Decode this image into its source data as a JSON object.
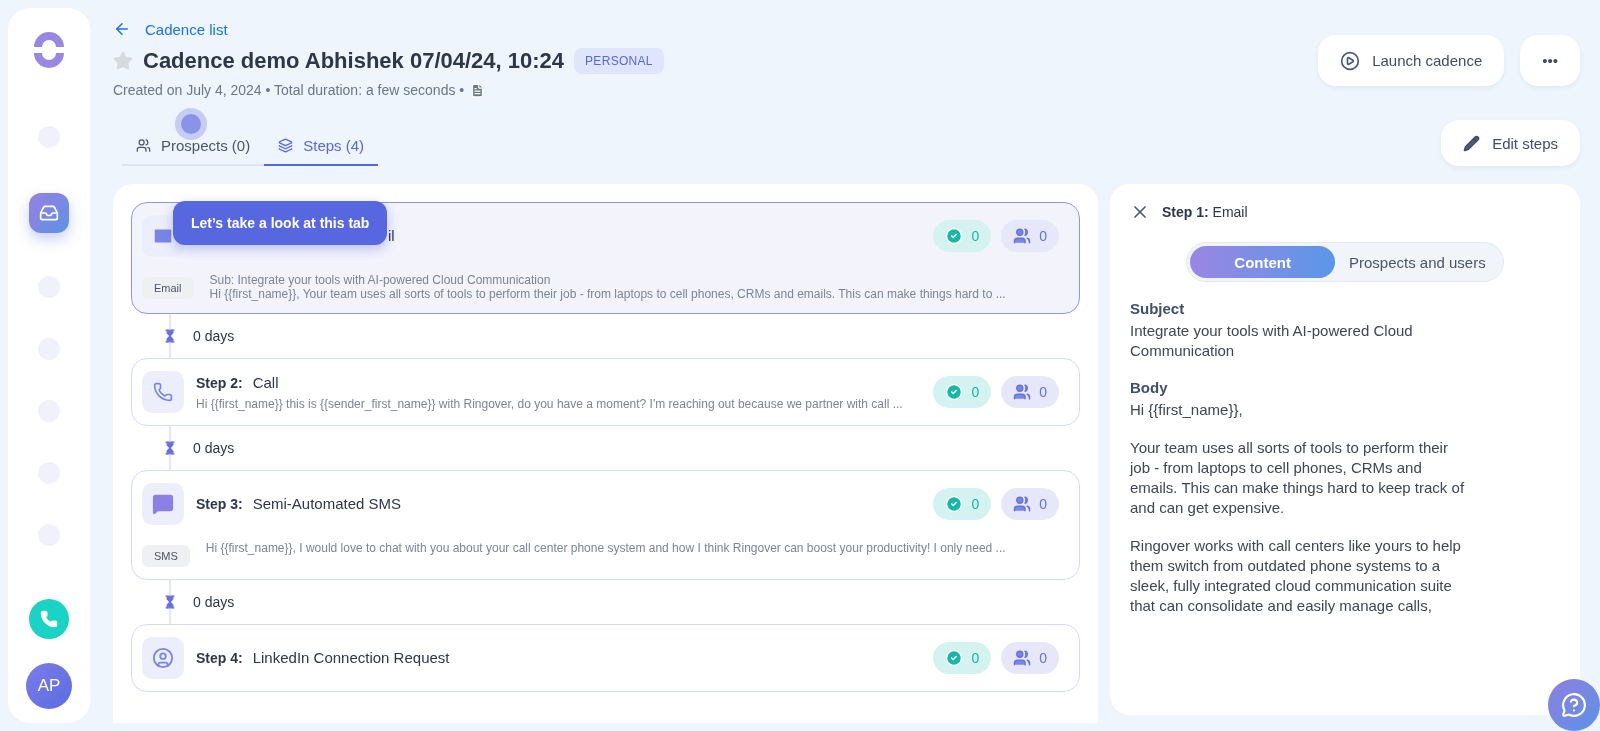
{
  "back_link": {
    "label": "Cadence list"
  },
  "header": {
    "starred": false,
    "title": "Cadence demo Abhishek 07/04/24, 10:24",
    "badge": "PERSONAL",
    "subtitle": "Created on July 4, 2024 • Total duration: a few seconds •"
  },
  "actions": [
    {
      "kind": "launch",
      "label": "Launch cadence"
    },
    {
      "kind": "more",
      "label": "•••"
    }
  ],
  "tabs": [
    {
      "kind": "prospects",
      "label": "Prospects (0)",
      "selected": false
    },
    {
      "kind": "steps",
      "label": "Steps (4)",
      "selected": true
    }
  ],
  "edit_button": {
    "label": "Edit steps"
  },
  "tooltip": {
    "text": "Let’s take a look at this tab"
  },
  "steps": [
    {
      "kind": "email",
      "title": "il",
      "tag": "Email",
      "lines": [
        "Sub: Integrate your tools with AI-powered Cloud Communication",
        "Hi {{first_name}},   Your team uses all sorts of tools to perform their job - from laptops to cell phones, CRMs and emails. This can make things hard to ..."
      ],
      "done": "0",
      "people": "0",
      "selected": true
    },
    {
      "kind": "call",
      "label": "Step 2:",
      "title": "Call",
      "lines": [
        "Hi {{first_name}} this is {{sender_first_name}} with Ringover, do you have a moment? I'm reaching out because we partner with call ..."
      ],
      "done": "0",
      "people": "0",
      "selected": false
    },
    {
      "kind": "sms",
      "label": "Step 3:",
      "title": "Semi-Automated SMS",
      "tag": "SMS",
      "lines": [
        "Hi {{first_name}}, I would love to chat with you about your call center phone system and how I think Ringover can boost your productivity! I only need ..."
      ],
      "done": "0",
      "people": "0",
      "selected": false
    },
    {
      "kind": "linkedin",
      "label": "Step 4:",
      "title": "LinkedIn Connection Request",
      "done": "0",
      "people": "0",
      "selected": false
    }
  ],
  "delays": [
    "0 days",
    "0 days",
    "0 days"
  ],
  "detail": {
    "label": "Step 1:",
    "title": "Email",
    "toggle": [
      {
        "label": "Content",
        "selected": true
      },
      {
        "label": "Prospects and users",
        "selected": false
      }
    ],
    "subject_heading": "Subject",
    "subject": "Integrate your tools with AI-powered Cloud Communication",
    "body_heading": "Body",
    "body": [
      "Hi {{first_name}},",
      "Your team uses all sorts of tools to perform their job - from laptops to cell phones, CRMs and emails. This can make things hard to keep track of and can get expensive.",
      "Ringover works with call centers like yours to help them switch from outdated phone systems to a sleek, fully integrated cloud communication suite that can consolidate and easily manage calls,"
    ]
  },
  "sidebar": {
    "items": [
      {
        "kind": "placeholder",
        "selected": false
      },
      {
        "kind": "cadences",
        "selected": true
      },
      {
        "kind": "placeholder",
        "selected": false
      },
      {
        "kind": "placeholder",
        "selected": false
      },
      {
        "kind": "placeholder",
        "selected": false
      },
      {
        "kind": "placeholder",
        "selected": false
      },
      {
        "kind": "placeholder",
        "selected": false
      }
    ],
    "avatar": "AP"
  }
}
